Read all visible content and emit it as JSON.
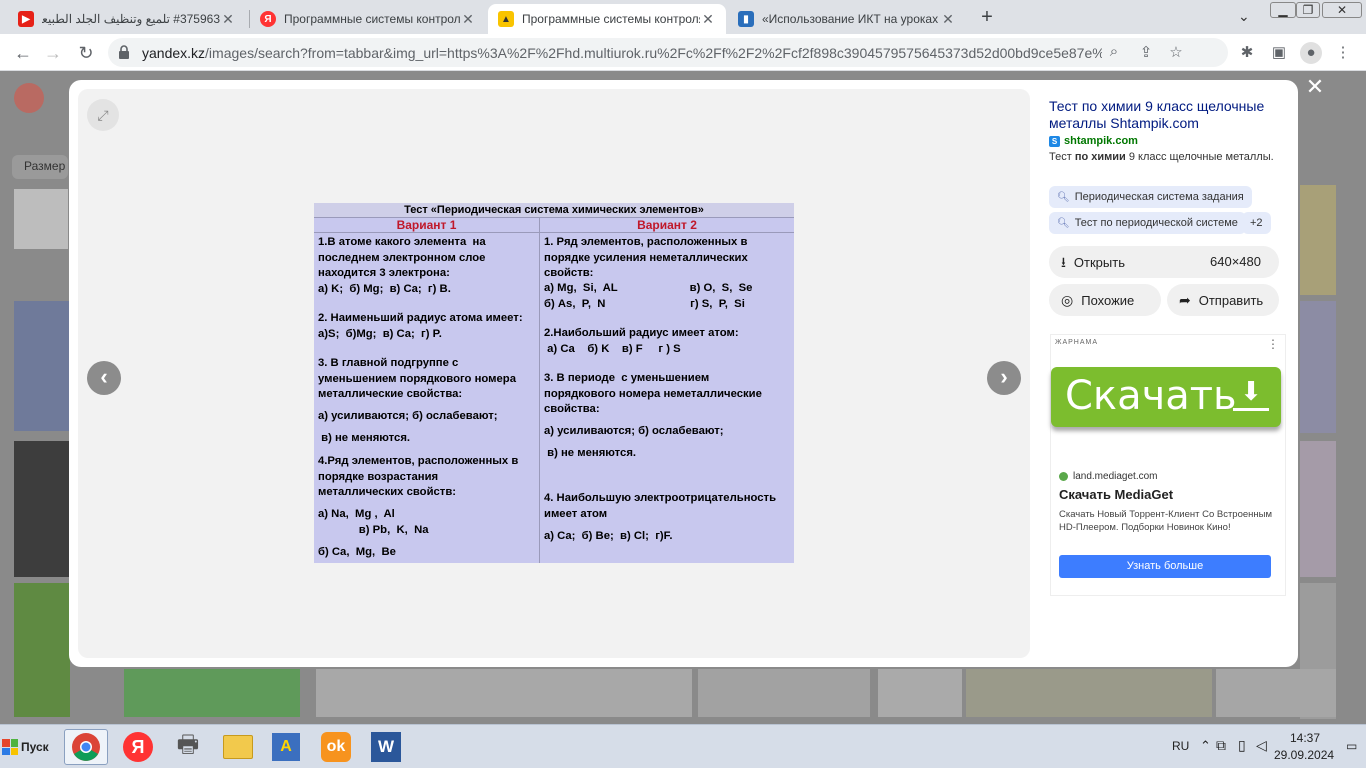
{
  "tabs": [
    {
      "title": "#375963 تلميع وتنظيف الجلد الطبيعي",
      "favicon_color": "#e62117",
      "favicon_text": "▶"
    },
    {
      "title": "Программные системы контроля знаний",
      "favicon_color": "#f33",
      "favicon_text": "Я"
    },
    {
      "title": "Программные системы контроля знаний",
      "favicon_color": "#f9c400",
      "favicon_text": "▲"
    },
    {
      "title": "«Использование ИКТ на уроках химии»",
      "favicon_color": "#2a6ebb",
      "favicon_text": "▮"
    }
  ],
  "address": {
    "domain": "yandex.kz",
    "path": "/images/search?from=tabbar&img_url=https%3A%2F%2Fhd.multiurok.ru%2Fc%2Ff%2F2%2Fcf2f898c3904579575645373d52d00bd9ce5e87e%..."
  },
  "background": {
    "size_label": "Размер"
  },
  "viewer": {
    "prev_icon": "chevron-left-icon",
    "next_icon": "chevron-right-icon"
  },
  "test_image": {
    "title": "Тест «Периодическая система химических элементов»",
    "variant1": {
      "header": "Вариант 1",
      "questions": [
        "1.В атоме какого элемента  на\nпоследнем электронном слое\nнаходится 3 электрона:\nа) K;  б) Mg;  в) Ca;  г) B.",
        "2. Наименьший радиус атома имеет:\nа)S;  б)Mg;  в) Ca;  г) P.",
        "3. В главной подгруппе с\nуменьшением порядкового номера\nметаллические свойства:",
        "а) усиливаются; б) ослабевают;",
        " в) не меняются.",
        "4.Ряд элементов, расположенных в\nпорядке возрастания\nметаллических свойств:",
        "а) Na,  Mg ,  Al\n             в) Pb,  K,  Na",
        "б) Ca,  Mg,  Be"
      ]
    },
    "variant2": {
      "header": "Вариант 2",
      "questions": [
        "1. Ряд элементов, расположенных в\nпорядке усиления неметаллических\nсвойств:",
        "а) Mg,  Si,  AL                       в) O,  S,  Se\nб) As,  P,  N                           г) S,  P,  Si",
        "2.Наибольший радиус имеет атом:\n а) Ca    б) K    в) F     г ) S",
        "3. В периоде  с уменьшением\nпорядкового номера неметаллические\nсвойства:",
        "а) усиливаются; б) ослабевают;",
        " в) не меняются.",
        "4. Наибольшую электроотрицательность\nимеет атом",
        "а) Ca;  б) Be;  в) Cl;  г)F."
      ]
    }
  },
  "result": {
    "title": "Тест по химии 9 класс щелочные металлы Shtampik.com",
    "source": "shtampik.com",
    "snippet_pre": "Тест ",
    "snippet_bold": "по химии",
    "snippet_post": " 9 класс щелочные металлы.",
    "chips": [
      "Периодическая система задания",
      "Тест по периодической системе",
      "+2"
    ],
    "open_label": "Открыть",
    "resolution": "640×480",
    "similar_label": "Похожие",
    "share_label": "Отправить"
  },
  "ad": {
    "label": "ЖАРНАМА",
    "banner_text": "Скачать",
    "domain": "land.mediaget.com",
    "headline": "Скачать MediaGet",
    "text": "Скачать Новый Торрент-Клиент Со Встроенным HD-Плеером. Подборки Новинок Кино!",
    "button": "Узнать больше"
  },
  "taskbar": {
    "start_label": "Пуск",
    "lang": "RU",
    "time": "14:37",
    "date": "29.09.2024"
  }
}
